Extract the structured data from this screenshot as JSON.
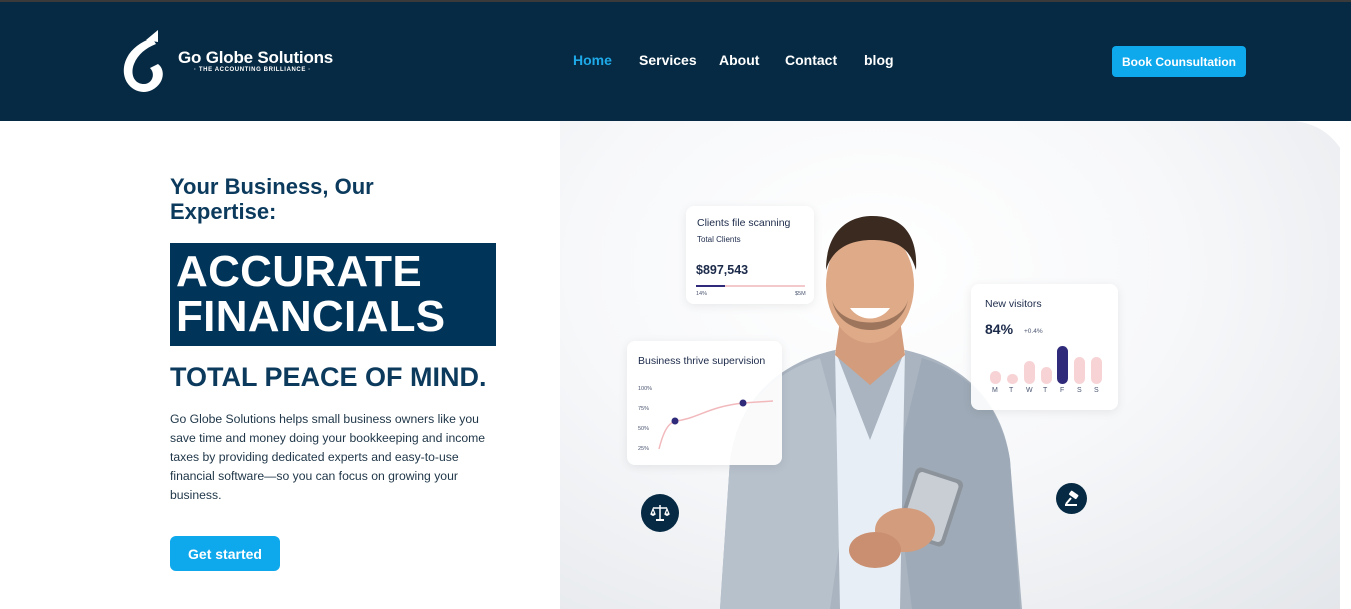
{
  "brand": {
    "name": "Go Globe Solutions",
    "tagline": "· THE ACCOUNTING BRILLIANCE ·"
  },
  "nav": {
    "items": [
      {
        "label": "Home",
        "active": true
      },
      {
        "label": "Services",
        "active": false
      },
      {
        "label": "About",
        "active": false
      },
      {
        "label": "Contact",
        "active": false
      },
      {
        "label": "blog",
        "active": false
      }
    ],
    "cta": "Book Counsultation"
  },
  "hero": {
    "intro": "Your Business, Our Expertise:",
    "highlight_line1": "ACCURATE",
    "highlight_line2": "FINANCIALS",
    "subheading": "TOTAL PEACE OF MIND.",
    "description": "Go Globe Solutions helps small business owners like you save time and money doing your bookkeeping and income taxes by providing dedicated experts and easy-to-use financial software—so you can focus on growing your business.",
    "cta": "Get started"
  },
  "cards": {
    "scanning": {
      "title": "Clients file scanning",
      "subtitle": "Total Clients",
      "value": "$897,543",
      "min_label": "14%",
      "max_label": "$5M",
      "progress": 0.27
    },
    "visitors": {
      "title": "New visitors",
      "value": "84%",
      "delta": "+0.4%",
      "days": [
        "M",
        "T",
        "W",
        "T",
        "F",
        "S",
        "S"
      ],
      "levels": [
        0.35,
        0.25,
        0.6,
        0.45,
        1.0,
        0.72,
        0.72
      ],
      "highlight_index": 4
    },
    "supervision": {
      "title": "Business thrive supervision",
      "y_ticks": [
        "100%",
        "75%",
        "50%",
        "25%"
      ]
    }
  },
  "colors": {
    "header_bg": "#062a43",
    "accent": "#0ea8ec",
    "highlight_bg": "#013459",
    "heading": "#0b3a5d"
  }
}
